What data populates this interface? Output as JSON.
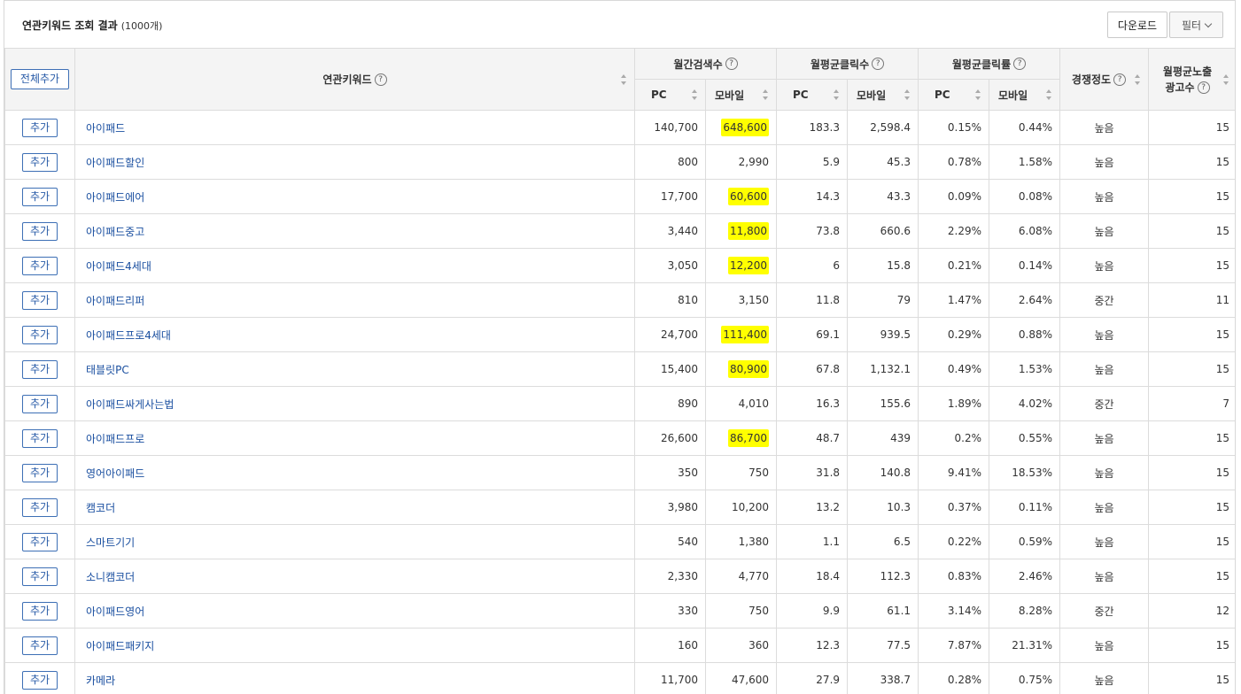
{
  "header": {
    "title": "연관키워드 조회 결과",
    "count": "(1000개)",
    "download_label": "다운로드",
    "filter_label": "필터"
  },
  "columns": {
    "all_add": "전체추가",
    "keyword": "연관키워드",
    "monthly_search": "월간검색수",
    "avg_clicks": "월평균클릭수",
    "avg_ctr": "월평균클릭률",
    "pc": "PC",
    "mobile": "모바일",
    "competition": "경쟁정도",
    "ad_count_line1": "월평균노출",
    "ad_count_line2": "광고수",
    "help": "?"
  },
  "row_add_label": "추가",
  "rows": [
    {
      "keyword": "아이패드",
      "pc_search": "140,700",
      "mobile_search": "648,600",
      "hl": true,
      "pc_click": "183.3",
      "mobile_click": "2,598.4",
      "pc_ctr": "0.15%",
      "mobile_ctr": "0.44%",
      "competition": "높음",
      "ads": "15"
    },
    {
      "keyword": "아이패드할인",
      "pc_search": "800",
      "mobile_search": "2,990",
      "hl": false,
      "pc_click": "5.9",
      "mobile_click": "45.3",
      "pc_ctr": "0.78%",
      "mobile_ctr": "1.58%",
      "competition": "높음",
      "ads": "15"
    },
    {
      "keyword": "아이패드에어",
      "pc_search": "17,700",
      "mobile_search": "60,600",
      "hl": true,
      "pc_click": "14.3",
      "mobile_click": "43.3",
      "pc_ctr": "0.09%",
      "mobile_ctr": "0.08%",
      "competition": "높음",
      "ads": "15"
    },
    {
      "keyword": "아이패드중고",
      "pc_search": "3,440",
      "mobile_search": "11,800",
      "hl": true,
      "pc_click": "73.8",
      "mobile_click": "660.6",
      "pc_ctr": "2.29%",
      "mobile_ctr": "6.08%",
      "competition": "높음",
      "ads": "15"
    },
    {
      "keyword": "아이패드4세대",
      "pc_search": "3,050",
      "mobile_search": "12,200",
      "hl": true,
      "pc_click": "6",
      "mobile_click": "15.8",
      "pc_ctr": "0.21%",
      "mobile_ctr": "0.14%",
      "competition": "높음",
      "ads": "15"
    },
    {
      "keyword": "아이패드리퍼",
      "pc_search": "810",
      "mobile_search": "3,150",
      "hl": false,
      "pc_click": "11.8",
      "mobile_click": "79",
      "pc_ctr": "1.47%",
      "mobile_ctr": "2.64%",
      "competition": "중간",
      "ads": "11"
    },
    {
      "keyword": "아이패드프로4세대",
      "pc_search": "24,700",
      "mobile_search": "111,400",
      "hl": true,
      "pc_click": "69.1",
      "mobile_click": "939.5",
      "pc_ctr": "0.29%",
      "mobile_ctr": "0.88%",
      "competition": "높음",
      "ads": "15"
    },
    {
      "keyword": "태블릿PC",
      "pc_search": "15,400",
      "mobile_search": "80,900",
      "hl": true,
      "pc_click": "67.8",
      "mobile_click": "1,132.1",
      "pc_ctr": "0.49%",
      "mobile_ctr": "1.53%",
      "competition": "높음",
      "ads": "15"
    },
    {
      "keyword": "아이패드싸게사는법",
      "pc_search": "890",
      "mobile_search": "4,010",
      "hl": false,
      "pc_click": "16.3",
      "mobile_click": "155.6",
      "pc_ctr": "1.89%",
      "mobile_ctr": "4.02%",
      "competition": "중간",
      "ads": "7"
    },
    {
      "keyword": "아이패드프로",
      "pc_search": "26,600",
      "mobile_search": "86,700",
      "hl": true,
      "pc_click": "48.7",
      "mobile_click": "439",
      "pc_ctr": "0.2%",
      "mobile_ctr": "0.55%",
      "competition": "높음",
      "ads": "15"
    },
    {
      "keyword": "영어아이패드",
      "pc_search": "350",
      "mobile_search": "750",
      "hl": false,
      "pc_click": "31.8",
      "mobile_click": "140.8",
      "pc_ctr": "9.41%",
      "mobile_ctr": "18.53%",
      "competition": "높음",
      "ads": "15"
    },
    {
      "keyword": "캠코더",
      "pc_search": "3,980",
      "mobile_search": "10,200",
      "hl": false,
      "pc_click": "13.2",
      "mobile_click": "10.3",
      "pc_ctr": "0.37%",
      "mobile_ctr": "0.11%",
      "competition": "높음",
      "ads": "15"
    },
    {
      "keyword": "스마트기기",
      "pc_search": "540",
      "mobile_search": "1,380",
      "hl": false,
      "pc_click": "1.1",
      "mobile_click": "6.5",
      "pc_ctr": "0.22%",
      "mobile_ctr": "0.59%",
      "competition": "높음",
      "ads": "15"
    },
    {
      "keyword": "소니캠코더",
      "pc_search": "2,330",
      "mobile_search": "4,770",
      "hl": false,
      "pc_click": "18.4",
      "mobile_click": "112.3",
      "pc_ctr": "0.83%",
      "mobile_ctr": "2.46%",
      "competition": "높음",
      "ads": "15"
    },
    {
      "keyword": "아이패드영어",
      "pc_search": "330",
      "mobile_search": "750",
      "hl": false,
      "pc_click": "9.9",
      "mobile_click": "61.1",
      "pc_ctr": "3.14%",
      "mobile_ctr": "8.28%",
      "competition": "중간",
      "ads": "12"
    },
    {
      "keyword": "아이패드패키지",
      "pc_search": "160",
      "mobile_search": "360",
      "hl": false,
      "pc_click": "12.3",
      "mobile_click": "77.5",
      "pc_ctr": "7.87%",
      "mobile_ctr": "21.31%",
      "competition": "높음",
      "ads": "15"
    },
    {
      "keyword": "카메라",
      "pc_search": "11,700",
      "mobile_search": "47,600",
      "hl": false,
      "pc_click": "27.9",
      "mobile_click": "338.7",
      "pc_ctr": "0.28%",
      "mobile_ctr": "0.75%",
      "competition": "높음",
      "ads": "15"
    }
  ]
}
